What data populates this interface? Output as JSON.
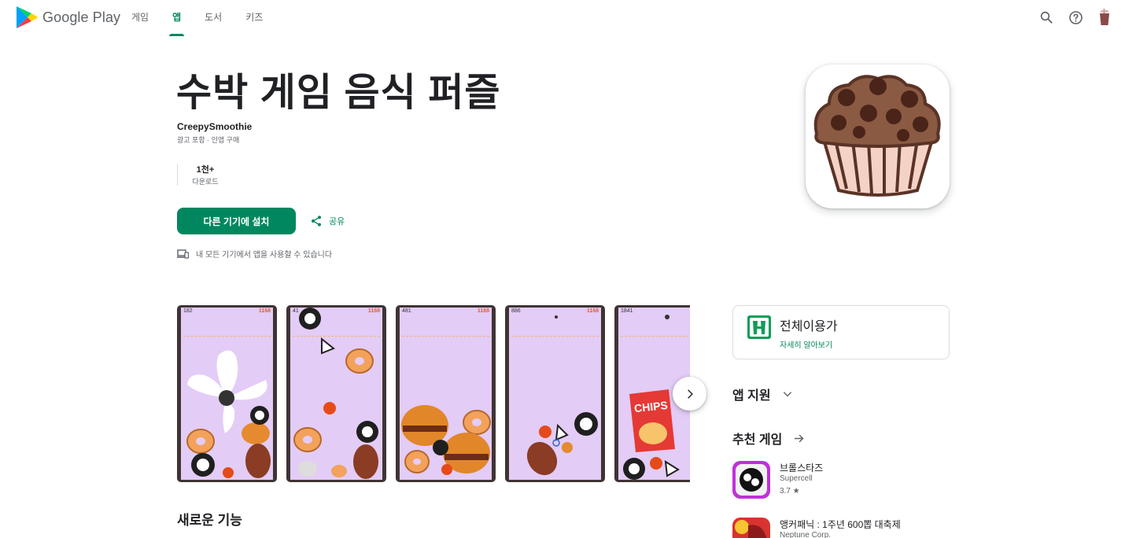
{
  "header": {
    "brand": "Google Play",
    "nav": [
      {
        "label": "게임",
        "active": false
      },
      {
        "label": "앱",
        "active": true
      },
      {
        "label": "도서",
        "active": false
      },
      {
        "label": "키즈",
        "active": false
      }
    ],
    "icons": [
      "search-icon",
      "help-icon",
      "account-avatar"
    ]
  },
  "app": {
    "title": "수박 게임 음식 퍼즐",
    "developer": "CreepySmoothie",
    "notes": "광고 포함 · 인앱 구매",
    "downloads_value": "1천+",
    "downloads_label": "다운로드",
    "install_label": "다른 기기에 설치",
    "share_label": "공유",
    "devices_note": "내 모든 기기에서 앱을 사용할 수 있습니다"
  },
  "screenshots": [
    {
      "score": "182",
      "best": "1168"
    },
    {
      "score": "41",
      "best": "1168"
    },
    {
      "score": "481",
      "best": "1168"
    },
    {
      "score": "886",
      "best": "1168"
    },
    {
      "score": "1841",
      "best": ""
    }
  ],
  "screenshot_text": "CHIPS",
  "sections": {
    "whats_new": "새로운 기능",
    "app_support": "앱 지원",
    "recommended": "추천 게임"
  },
  "rating": {
    "label": "전체이용가",
    "link": "자세히 알아보기"
  },
  "recommended": [
    {
      "name": "브롤스타즈",
      "developer": "Supercell",
      "rating": "3.7 ★"
    },
    {
      "name": "앵커패닉 : 1주년 600뽑 대축제",
      "developer": "Neptune Corp.",
      "rating": ""
    }
  ],
  "colors": {
    "accent": "#01875f",
    "text": "#202124",
    "secondary": "#5f6368",
    "screenshot_bg": "#e3ccf6"
  }
}
